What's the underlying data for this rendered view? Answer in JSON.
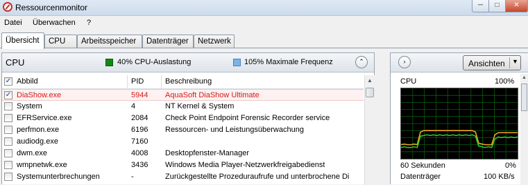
{
  "window": {
    "title": "Ressourcenmonitor"
  },
  "menu": [
    "Datei",
    "Überwachen",
    "?"
  ],
  "tabs": [
    "Übersicht",
    "CPU",
    "Arbeitsspeicher",
    "Datenträger",
    "Netzwerk"
  ],
  "cpu_panel": {
    "title": "CPU",
    "usage_text": "40% CPU-Auslastung",
    "freq_text": "105% Maximale Frequenz",
    "colors": {
      "usage": "#0f8a0f",
      "frequency": "#79b4ea"
    },
    "columns": [
      "Abbild",
      "PID",
      "Beschreibung"
    ],
    "rows": [
      {
        "name": "DiaShow.exe",
        "pid": "5944",
        "desc": "AquaSoft DiaShow Ultimate",
        "checked": true
      },
      {
        "name": "System",
        "pid": "4",
        "desc": "NT Kernel & System",
        "checked": false
      },
      {
        "name": "EFRService.exe",
        "pid": "2084",
        "desc": "Check Point Endpoint Forensic Recorder service",
        "checked": false
      },
      {
        "name": "perfmon.exe",
        "pid": "6196",
        "desc": "Ressourcen- und Leistungsüberwachung",
        "checked": false
      },
      {
        "name": "audiodg.exe",
        "pid": "7160",
        "desc": "",
        "checked": false
      },
      {
        "name": "dwm.exe",
        "pid": "4008",
        "desc": "Desktopfenster-Manager",
        "checked": false
      },
      {
        "name": "wmpnetwk.exe",
        "pid": "3436",
        "desc": "Windows Media Player-Netzwerkfreigabedienst",
        "checked": false
      },
      {
        "name": "Systemunterbrechungen",
        "pid": "-",
        "desc": "Zurückgestellte Prozeduraufrufe und unterbrochene Di",
        "checked": false
      }
    ]
  },
  "side_panel": {
    "views_label": "Ansichten",
    "cpu_label": "CPU",
    "cpu_max": "100%",
    "time_label": "60 Sekunden",
    "cpu_min": "0%",
    "disk_label": "Datenträger",
    "disk_value": "100 KB/s"
  },
  "chart_data": {
    "type": "line",
    "ylim": [
      0,
      100
    ],
    "series": [
      {
        "color": "#f5a623",
        "values": [
          20,
          21,
          20,
          20,
          21,
          20,
          38,
          40,
          40,
          40,
          40,
          40,
          40,
          40,
          40,
          40,
          40,
          40,
          40,
          40,
          40,
          40,
          40,
          38,
          22,
          21,
          20,
          20,
          20,
          34,
          37,
          37,
          37,
          37,
          37,
          37,
          37
        ]
      },
      {
        "color": "#2ccc2c",
        "values": [
          16,
          17,
          16,
          16,
          17,
          16,
          32,
          33,
          34,
          33,
          34,
          33,
          34,
          33,
          34,
          33,
          34,
          33,
          34,
          33,
          34,
          33,
          34,
          32,
          18,
          17,
          16,
          17,
          16,
          28,
          31,
          30,
          31,
          30,
          31,
          30,
          31
        ]
      }
    ]
  }
}
